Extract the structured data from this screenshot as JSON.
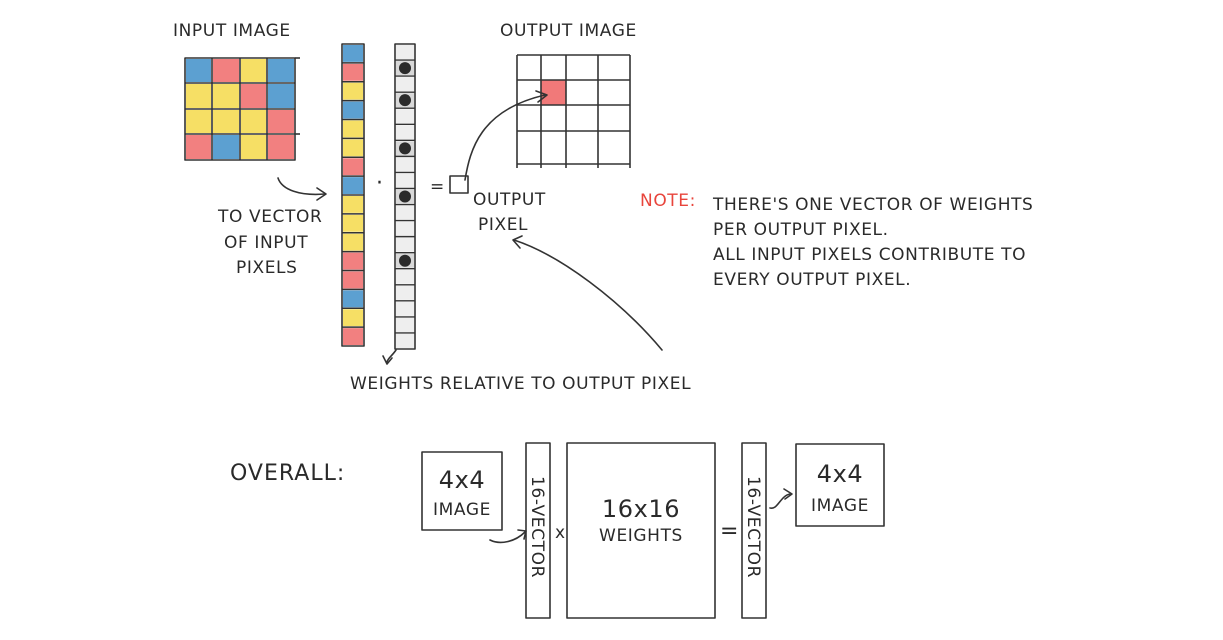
{
  "labels": {
    "input_image": "INPUT IMAGE",
    "output_image": "OUTPUT IMAGE",
    "to_vector": [
      "TO VECTOR",
      "OF INPUT",
      "PIXELS"
    ],
    "dot": "·",
    "equals": "=",
    "output_pixel": [
      "OUTPUT",
      "PIXEL"
    ],
    "note_label": "NOTE:",
    "note_lines": [
      "THERE'S ONE VECTOR OF WEIGHTS",
      "PER OUTPUT PIXEL.",
      "ALL INPUT PIXELS CONTRIBUTE TO",
      "EVERY OUTPUT PIXEL."
    ],
    "weights_caption": "WEIGHTS RELATIVE TO OUTPUT PIXEL",
    "overall": "OVERALL:",
    "box1": [
      "4x4",
      "IMAGE"
    ],
    "vector1": "16-VECTOR",
    "times": "x",
    "weights_box": [
      "16x16",
      "WEIGHTS"
    ],
    "equals2": "=",
    "vector2": "16-VECTOR",
    "box2": [
      "4x4",
      "IMAGE"
    ]
  },
  "colors": {
    "red": "#f06a6a",
    "yellow": "#f5d94a",
    "blue": "#3f8fc9",
    "light": "#eeeeee",
    "dark": "#2b2b2b",
    "note": "#e8453c",
    "yellow_fill": "#fbf5cf",
    "blue_fill": "#dceaf5",
    "grey_fill": "#f4f4f4"
  },
  "input_grid": [
    [
      "blue",
      "red",
      "yellow",
      "blue"
    ],
    [
      "yellow",
      "yellow",
      "red",
      "blue"
    ],
    [
      "yellow",
      "yellow",
      "yellow",
      "red"
    ],
    [
      "red",
      "blue",
      "yellow",
      "red"
    ]
  ],
  "input_vector": [
    "blue",
    "red",
    "yellow",
    "blue",
    "yellow",
    "yellow",
    "red",
    "blue",
    "yellow",
    "yellow",
    "yellow",
    "red",
    "red",
    "blue",
    "yellow",
    "red"
  ],
  "weight_vector": [
    "light",
    "dark",
    "light",
    "dark",
    "light",
    "light",
    "dark",
    "light",
    "light",
    "dark",
    "light",
    "light",
    "light",
    "dark",
    "light",
    "light"
  ],
  "output_highlight": {
    "row": 1,
    "col": 1
  }
}
